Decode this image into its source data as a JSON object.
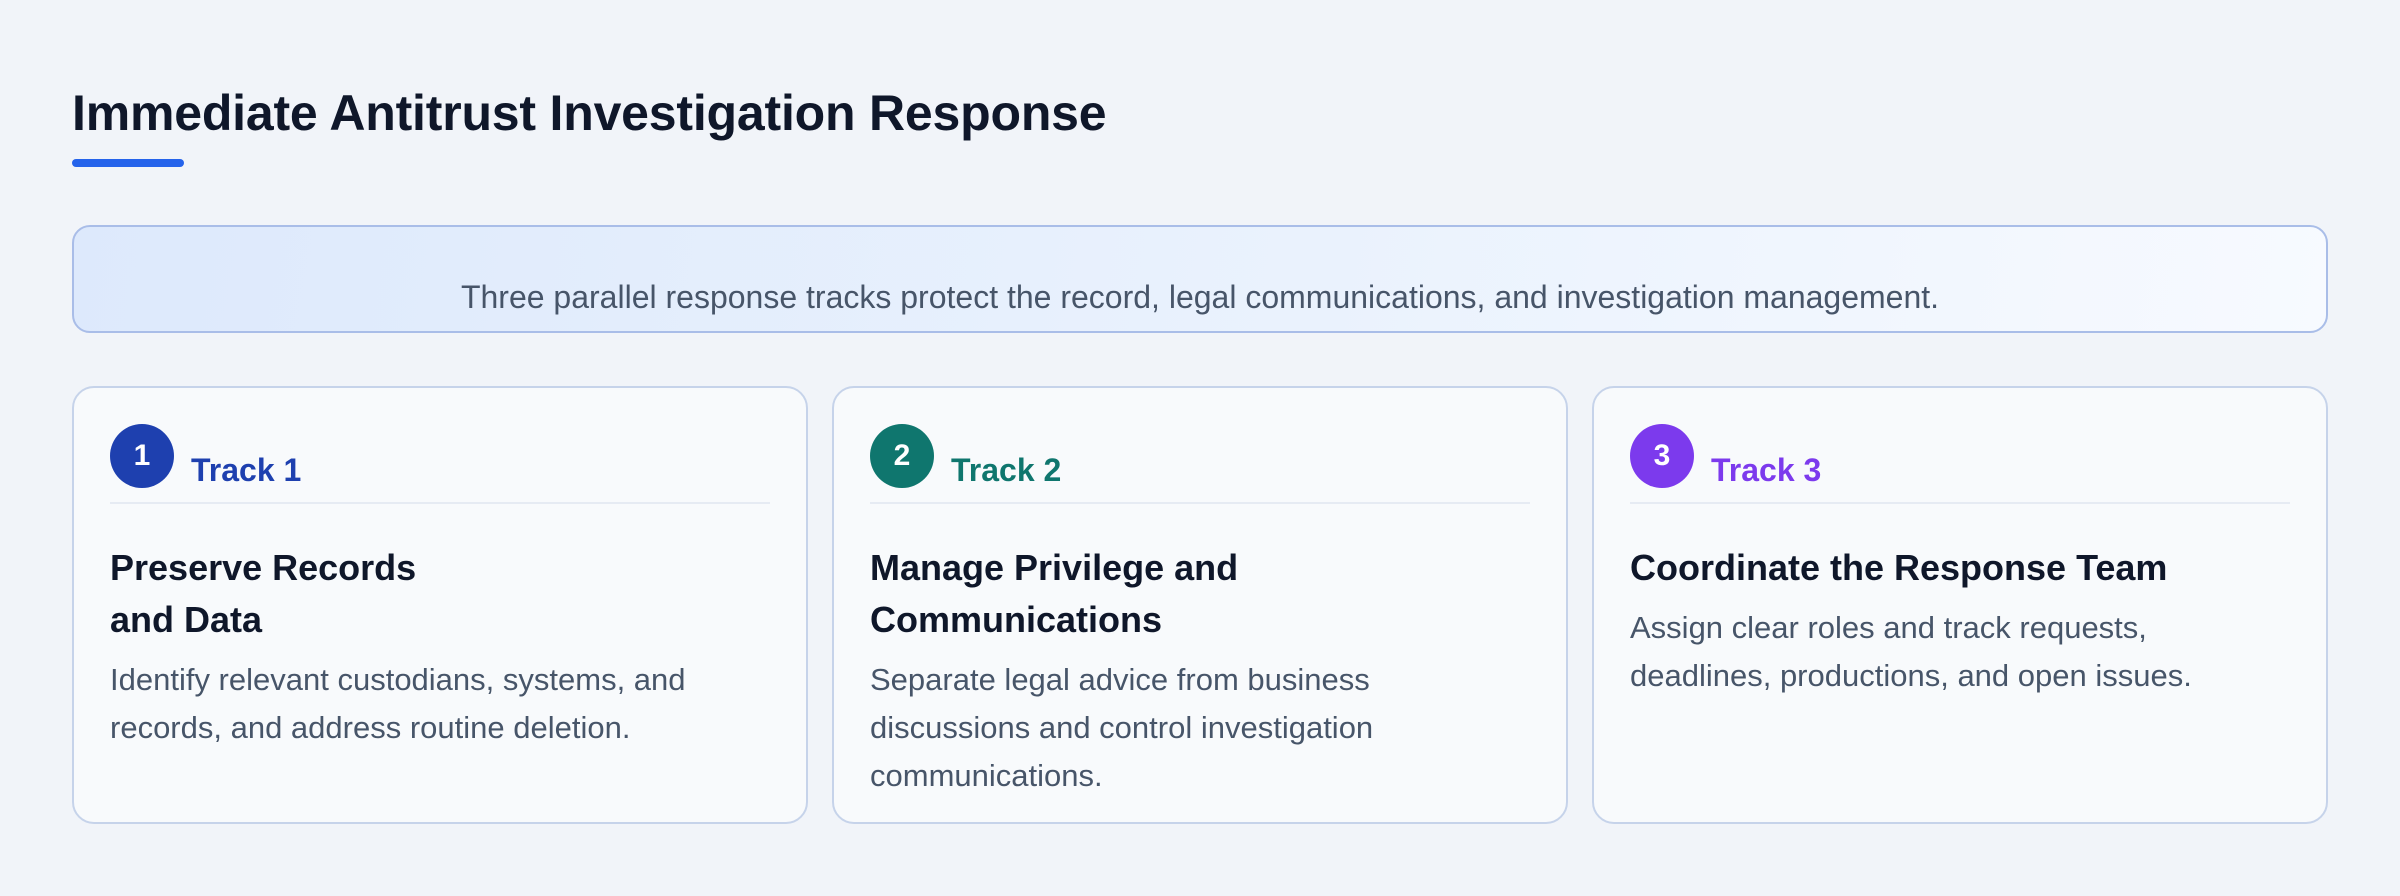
{
  "header": {
    "title": "Immediate Antitrust Investigation Response"
  },
  "summary": {
    "text": "Three parallel response tracks protect the record, legal communications, and investigation management."
  },
  "colors": {
    "accent": "#2563eb",
    "track1": "#1e40af",
    "track2": "#0f766e",
    "track3": "#7c3aed"
  },
  "tracks": [
    {
      "number": "1",
      "label": "Track 1",
      "title": "Preserve Records and Data",
      "description": "Identify relevant custodians, systems, and records, and address routine deletion.",
      "color": "#1e40af"
    },
    {
      "number": "2",
      "label": "Track 2",
      "title": "Manage Privilege and Communications",
      "description": "Separate legal advice from business discussions and control investigation communications.",
      "color": "#0f766e"
    },
    {
      "number": "3",
      "label": "Track 3",
      "title": "Coordinate the Response Team",
      "description": "Assign clear roles and track requests, deadlines, productions, and open issues.",
      "color": "#7c3aed"
    }
  ]
}
